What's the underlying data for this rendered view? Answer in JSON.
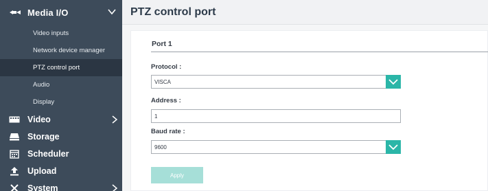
{
  "sidebar": {
    "media": {
      "label": "Media I/O",
      "icon": "media-io-icon",
      "items": [
        {
          "label": "Video inputs"
        },
        {
          "label": "Network device manager"
        },
        {
          "label": "PTZ control port"
        },
        {
          "label": "Audio"
        },
        {
          "label": "Display"
        }
      ]
    },
    "menu": [
      {
        "label": "Video",
        "icon": "video-icon"
      },
      {
        "label": "Storage",
        "icon": "storage-icon"
      },
      {
        "label": "Scheduler",
        "icon": "calendar-icon"
      },
      {
        "label": "Upload",
        "icon": "upload-icon"
      },
      {
        "label": "System",
        "icon": "tools-icon"
      }
    ]
  },
  "header": {
    "title": "PTZ control port"
  },
  "form": {
    "section_title": "Port 1",
    "protocol_label": "Protocol :",
    "protocol_value": "VISCA",
    "address_label": "Address :",
    "address_value": "1",
    "baud_label": "Baud rate :",
    "baud_value": "9600",
    "apply_label": "Apply"
  },
  "colors": {
    "sidebar_bg": "#3d4b5a",
    "sidebar_active_bg": "#2b3643",
    "accent": "#2bb6a8",
    "apply_disabled": "#a6dfd8"
  }
}
